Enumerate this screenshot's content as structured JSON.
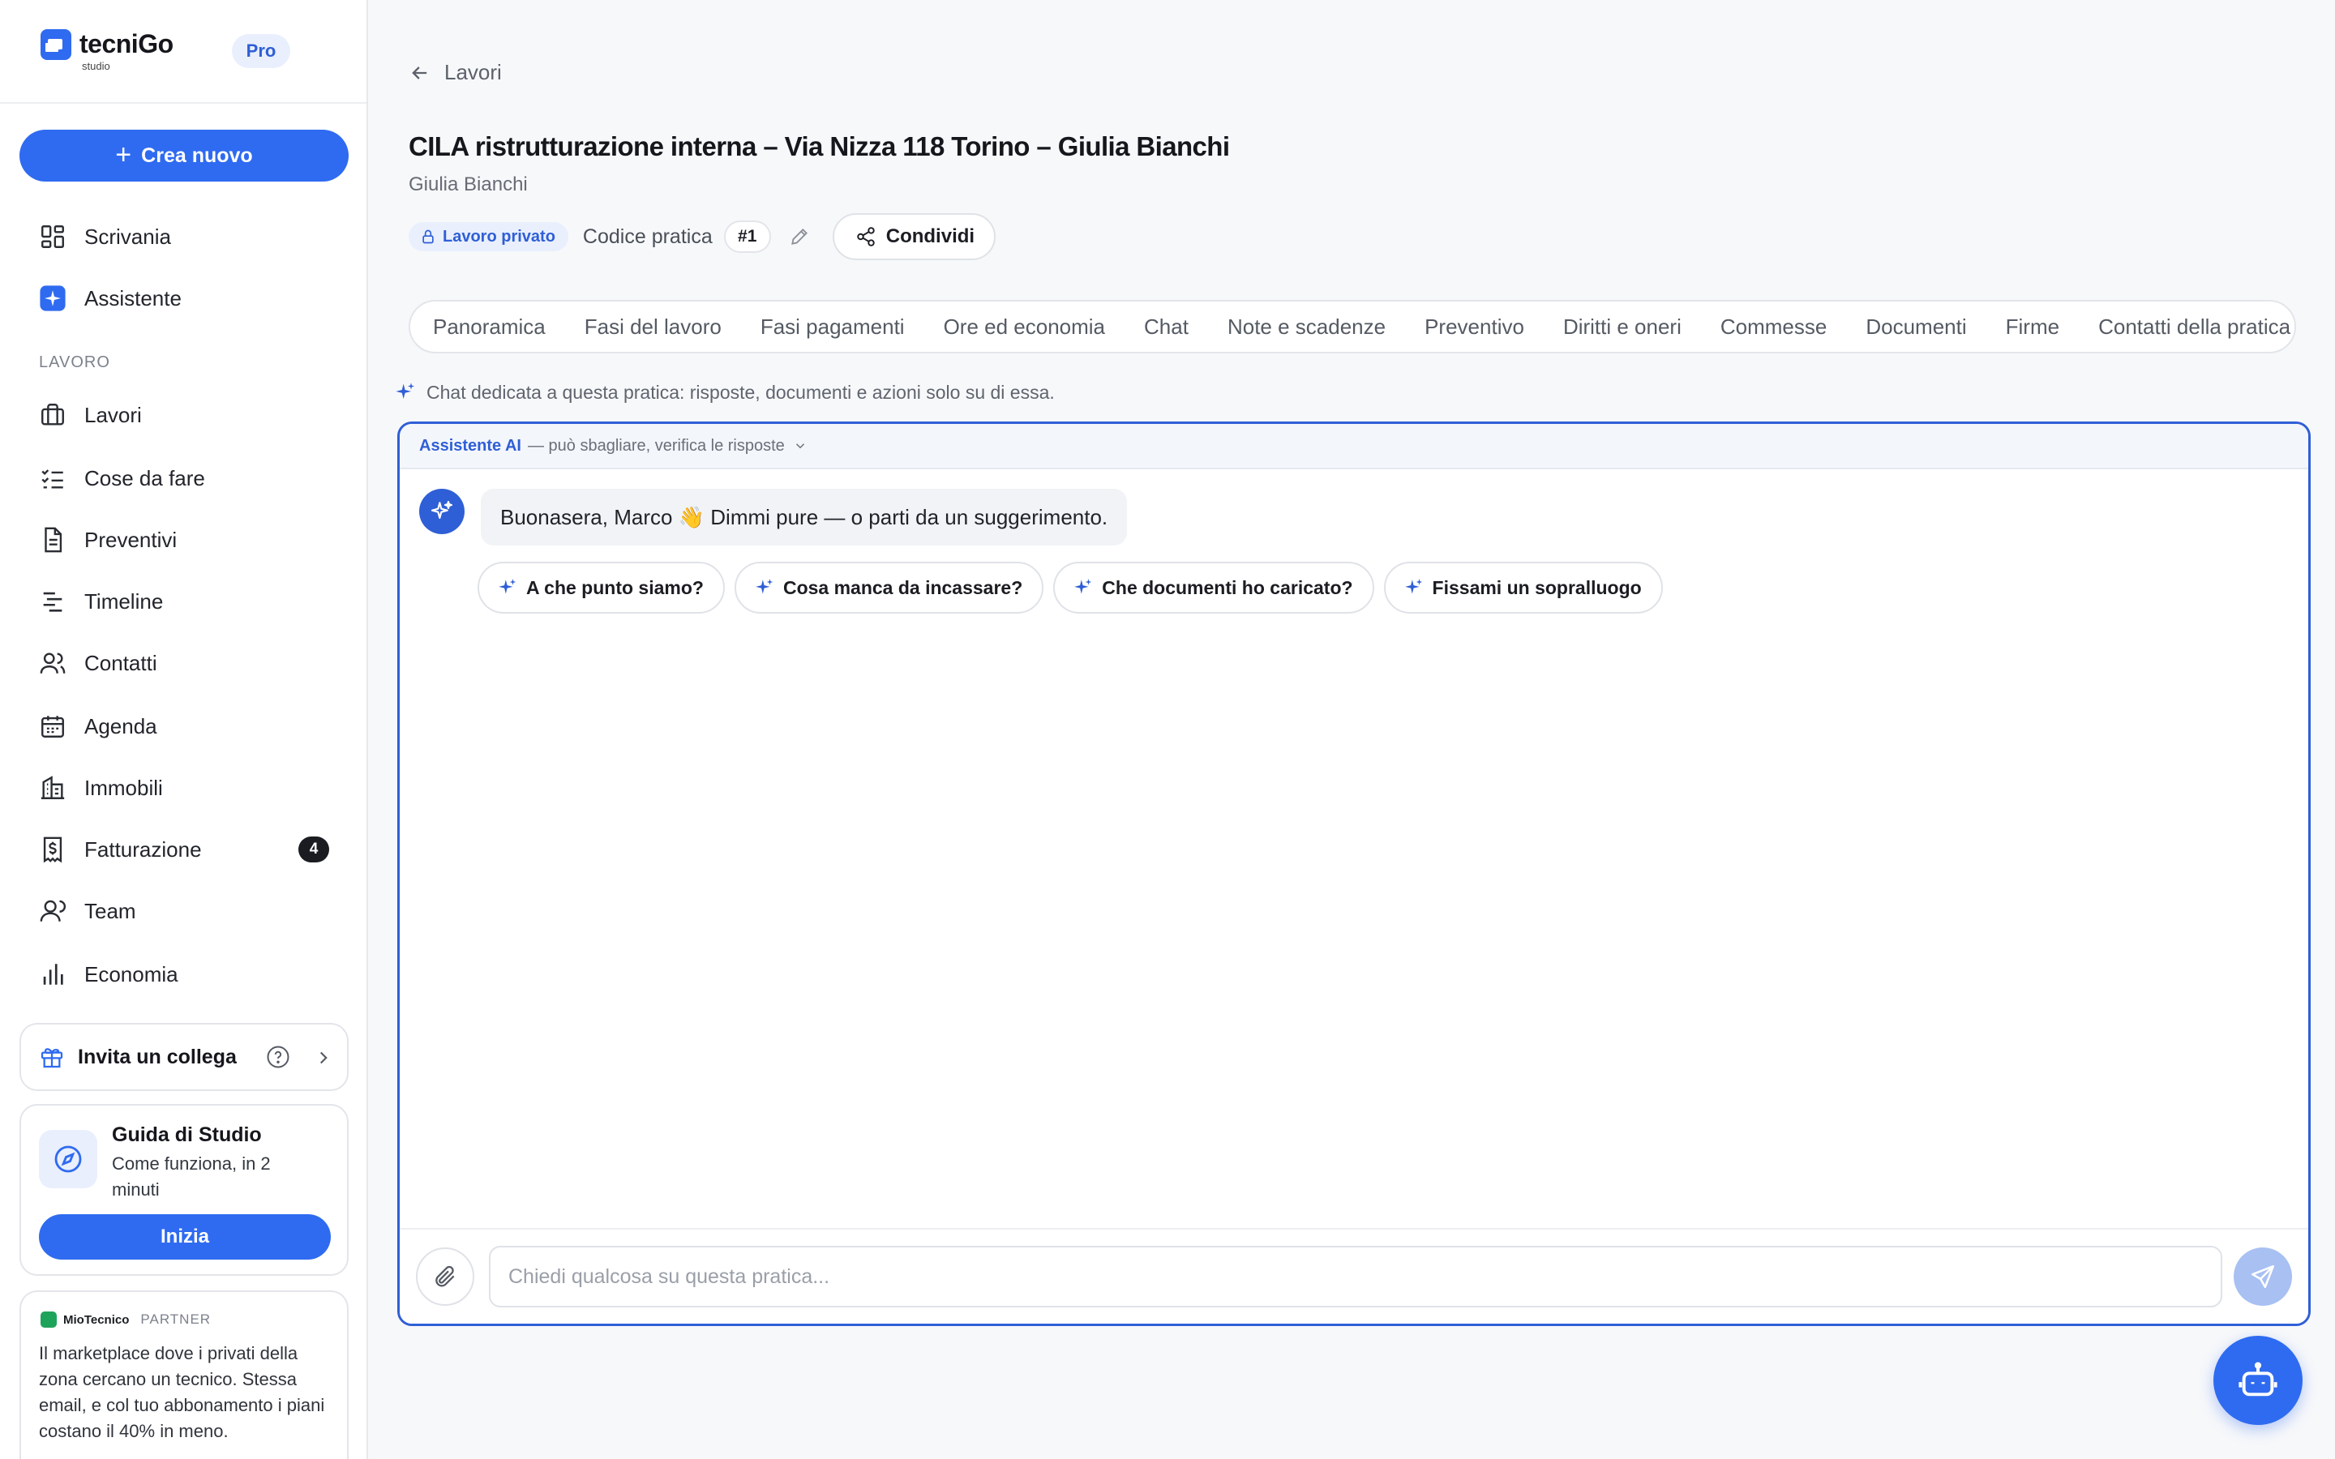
{
  "brand": {
    "name": "tecniGo",
    "sub": "studio",
    "plan": "Pro"
  },
  "sidebar": {
    "create_label": "Crea nuovo",
    "top_items": [
      {
        "label": "Scrivania",
        "icon": "grid-icon"
      },
      {
        "label": "Assistente",
        "icon": "sparkle-icon"
      }
    ],
    "section_label": "LAVORO",
    "items": [
      {
        "label": "Lavori",
        "icon": "briefcase-icon"
      },
      {
        "label": "Cose da fare",
        "icon": "checklist-icon"
      },
      {
        "label": "Preventivi",
        "icon": "document-icon"
      },
      {
        "label": "Timeline",
        "icon": "timeline-icon"
      },
      {
        "label": "Contatti",
        "icon": "users-icon"
      },
      {
        "label": "Agenda",
        "icon": "calendar-icon"
      },
      {
        "label": "Immobili",
        "icon": "building-icon"
      },
      {
        "label": "Fatturazione",
        "icon": "invoice-icon",
        "badge": "4"
      },
      {
        "label": "Team",
        "icon": "team-icon"
      },
      {
        "label": "Economia",
        "icon": "bar-chart-icon"
      }
    ],
    "invite": {
      "label": "Invita un collega"
    },
    "guide": {
      "title": "Guida di Studio",
      "subtitle": "Come funziona, in 2 minuti",
      "button": "Inizia"
    },
    "partner": {
      "brand": "MioTecnico",
      "tag": "PARTNER",
      "text": "Il marketplace dove i privati della zona cercano un tecnico. Stessa email, e col tuo abbonamento i piani costano il 40% in meno."
    }
  },
  "header": {
    "back_label": "Lavori",
    "title": "CILA ristrutturazione interna – Via Nizza 118 Torino – Giulia Bianchi",
    "client": "Giulia Bianchi",
    "private_label": "Lavoro privato",
    "code_label": "Codice pratica",
    "code_value": "#1",
    "share_label": "Condividi"
  },
  "tabs": [
    "Panoramica",
    "Fasi del lavoro",
    "Fasi pagamenti",
    "Ore ed economia",
    "Chat",
    "Note e scadenze",
    "Preventivo",
    "Diritti e oneri",
    "Commesse",
    "Documenti",
    "Firme",
    "Contatti della pratica"
  ],
  "chat": {
    "note": "Chat dedicata a questa pratica: risposte, documenti e azioni solo su di essa.",
    "header_ai": "Assistente AI",
    "header_disclaimer": "— può sbagliare, verifica le risposte",
    "greeting": "Buonasera, Marco 👋 Dimmi pure — o parti da un suggerimento.",
    "suggestions": [
      "A che punto siamo?",
      "Cosa manca da incassare?",
      "Che documenti ho caricato?",
      "Fissami un sopralluogo"
    ],
    "input_placeholder": "Chiedi qualcosa su questa pratica..."
  },
  "colors": {
    "accent": "#2f6bf0",
    "accent_dark": "#2f5fd6",
    "accent_soft": "#e9effc",
    "partner_green": "#1ea35b"
  }
}
